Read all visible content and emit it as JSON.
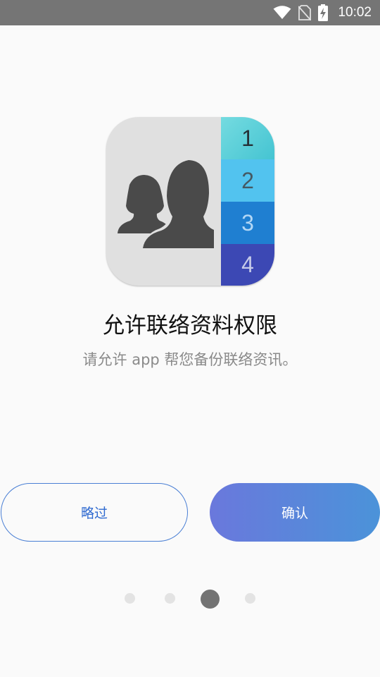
{
  "status_bar": {
    "time": "10:02",
    "icons": [
      "wifi-icon",
      "no-sim-icon",
      "battery-charging-icon"
    ]
  },
  "app_icon": {
    "name": "contacts-icon",
    "tabs": [
      "1",
      "2",
      "3",
      "4"
    ],
    "colors": [
      "#4fcad6",
      "#52c3ef",
      "#1f7fd1",
      "#3c48b4"
    ]
  },
  "main": {
    "title": "允许联络资料权限",
    "subtitle": "请允许 app 帮您备份联络资讯。"
  },
  "buttons": {
    "skip": "略过",
    "confirm": "确认"
  },
  "pager": {
    "count": 4,
    "active_index": 2
  },
  "colors": {
    "accent": "#2f6ad0",
    "confirm_gradient_start": "#6a78dc",
    "confirm_gradient_end": "#4b93d9"
  }
}
